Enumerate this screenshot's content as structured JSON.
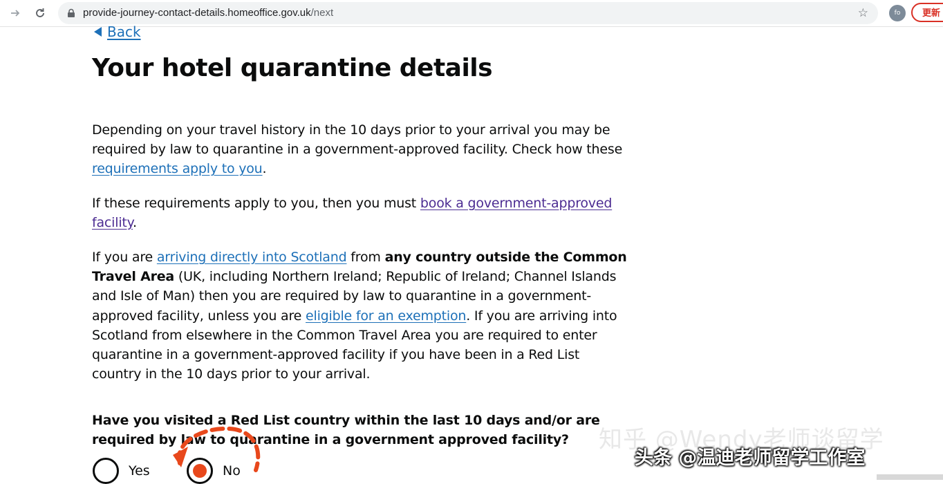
{
  "browser": {
    "url_domain": "provide-journey-contact-details.homeoffice.gov.uk",
    "url_path": "/next",
    "avatar_text": "fo",
    "update_label": "更新"
  },
  "page": {
    "back_label": "Back",
    "title": "Your hotel quarantine details",
    "p1": {
      "text": "Depending on your travel history in the 10 days prior to your arrival you may be required by law to quarantine in a government-approved facility. Check how these ",
      "link": "requirements apply to you",
      "end": "."
    },
    "p2": {
      "text": "If these requirements apply to you, then you must ",
      "link": "book a government-approved facility",
      "end": "."
    },
    "p3": {
      "a": "If you are ",
      "link1": "arriving directly into Scotland",
      "b": " from ",
      "bold": "any country outside the Common Travel Area",
      "c": " (UK, including Northern Ireland; Republic of Ireland; Channel Islands and Isle of Man) then you are required by law to quarantine in a government-approved facility, unless you are ",
      "link2": "eligible for an exemption",
      "d": ". If you are arriving into Scotland from elsewhere in the Common Travel Area you are required to enter quarantine in a government-approved facility if you have been in a Red List country in the 10 days prior to your arrival."
    },
    "question": "Have you visited a Red List country within the last 10 days and/or are required by law to quarantine in a government approved facility?",
    "options": [
      {
        "label": "Yes",
        "selected": false
      },
      {
        "label": "No",
        "selected": true
      }
    ]
  },
  "watermarks": {
    "zhihu": "知乎 @Wendy老师谈留学",
    "toutiao": "头条 @温迪老师留学工作室"
  },
  "colors": {
    "link": "#1d70b8",
    "visited_link": "#4c2c92",
    "text": "#0b0c0c",
    "annotation": "#e8481c"
  }
}
